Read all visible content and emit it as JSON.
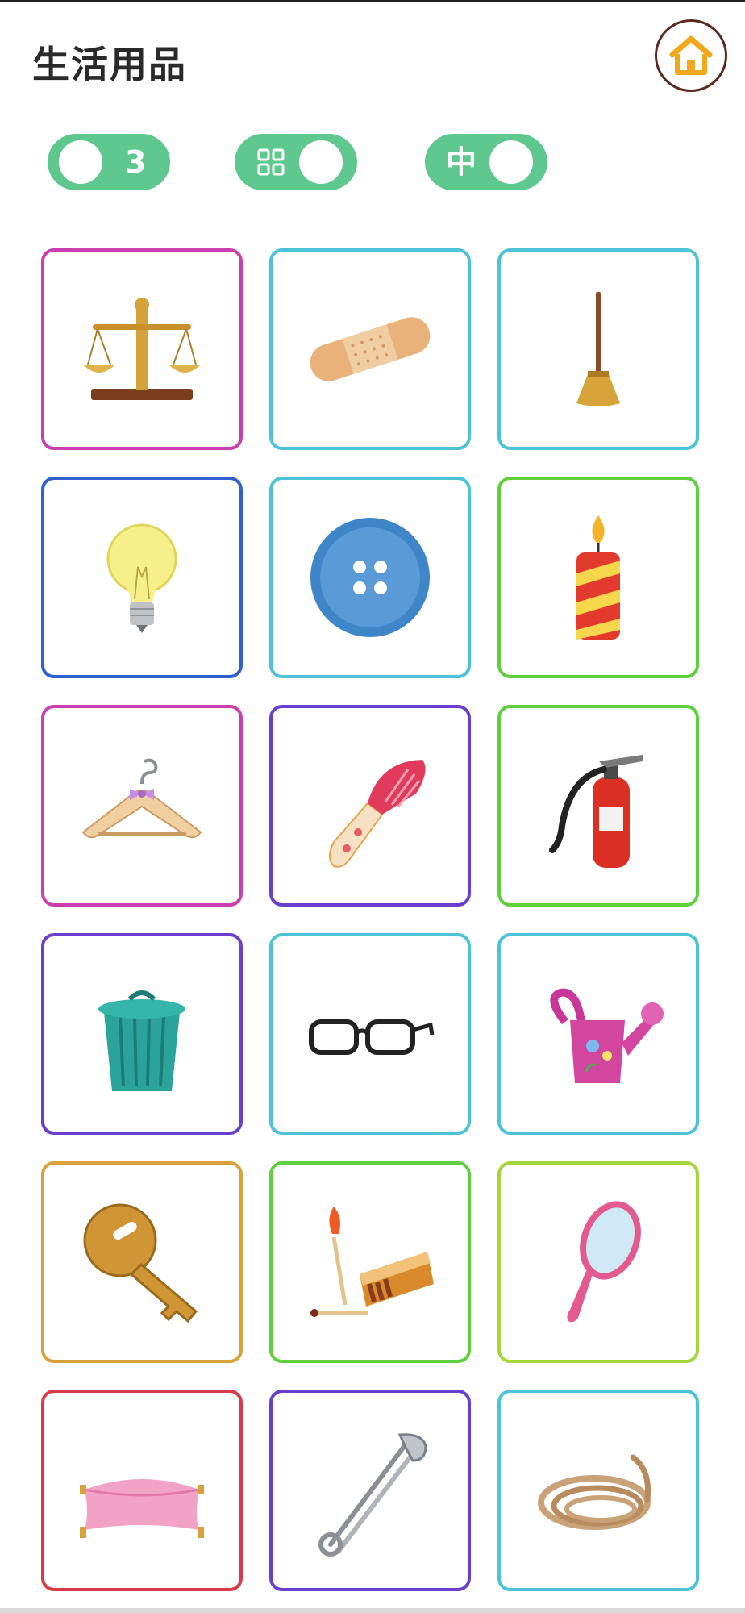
{
  "header": {
    "title": "生活用品"
  },
  "toggles": {
    "count_label": "3",
    "layout_icon": "grid-icon",
    "size_label": "中"
  },
  "colors": {
    "toggle_bg": "#5ec88e",
    "home_icon": "#f2a81c",
    "home_ring": "#5a2a1c"
  },
  "items": [
    {
      "name": "scale",
      "icon": "balance-scale-icon",
      "border": "#c93fb0"
    },
    {
      "name": "bandage",
      "icon": "bandage-icon",
      "border": "#4cc3d6"
    },
    {
      "name": "broom",
      "icon": "broom-icon",
      "border": "#4cc3d6"
    },
    {
      "name": "light-bulb",
      "icon": "light-bulb-icon",
      "border": "#2f5fd0"
    },
    {
      "name": "button",
      "icon": "button-icon",
      "border": "#4cc3d6"
    },
    {
      "name": "candle",
      "icon": "candle-icon",
      "border": "#5fcf3f"
    },
    {
      "name": "hanger",
      "icon": "hanger-icon",
      "border": "#c93fb0"
    },
    {
      "name": "comb",
      "icon": "comb-icon",
      "border": "#6a3fcf"
    },
    {
      "name": "fire-extinguisher",
      "icon": "fire-extinguisher-icon",
      "border": "#5fcf3f"
    },
    {
      "name": "trash-can",
      "icon": "trash-can-icon",
      "border": "#6a3fcf"
    },
    {
      "name": "glasses",
      "icon": "glasses-icon",
      "border": "#4cc3d6"
    },
    {
      "name": "watering-can",
      "icon": "watering-can-icon",
      "border": "#4cc3d6"
    },
    {
      "name": "key",
      "icon": "key-icon",
      "border": "#d9a13a"
    },
    {
      "name": "matches",
      "icon": "matches-icon",
      "border": "#5fcf3f"
    },
    {
      "name": "hand-mirror",
      "icon": "hand-mirror-icon",
      "border": "#a6d63a"
    },
    {
      "name": "pillow",
      "icon": "pillow-icon",
      "border": "#d93a4a"
    },
    {
      "name": "safety-pin",
      "icon": "safety-pin-icon",
      "border": "#6a3fcf"
    },
    {
      "name": "rope",
      "icon": "rope-icon",
      "border": "#4cc3d6"
    }
  ]
}
